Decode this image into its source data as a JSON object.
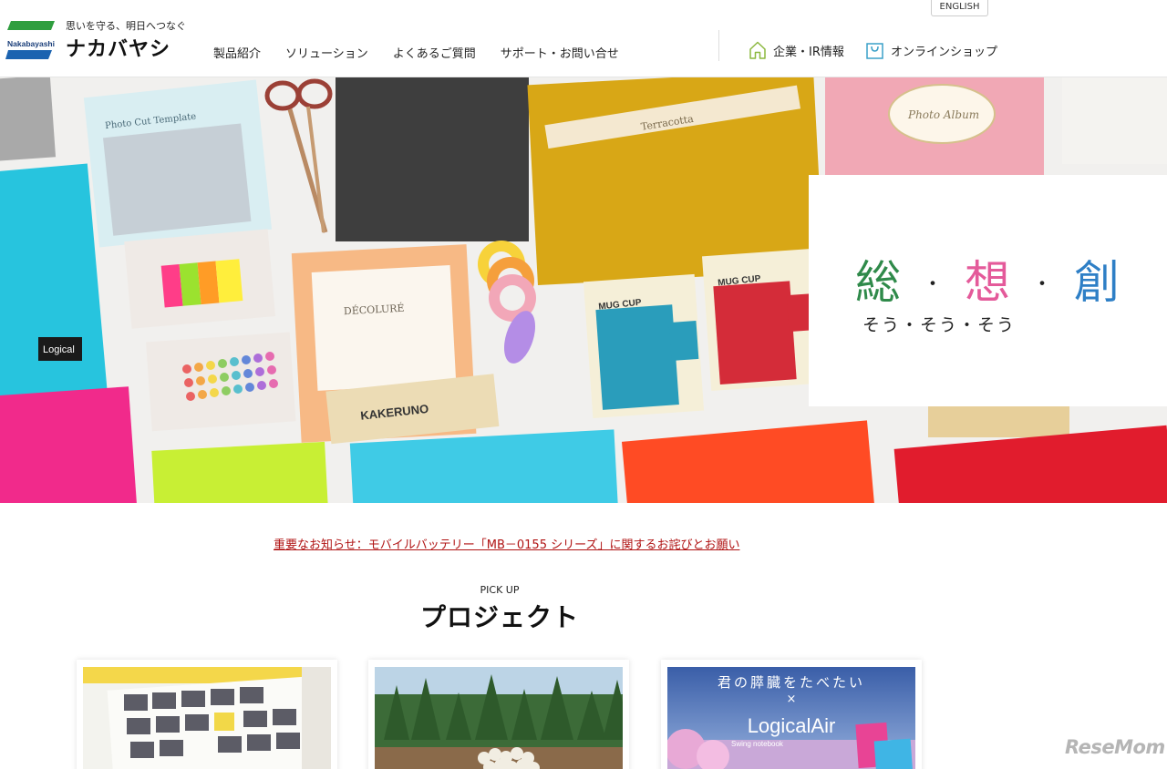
{
  "header": {
    "tagline": "思いを守る、明日へつなぐ",
    "logo_mark_text": "Nakabayashi",
    "logo_name": "ナカバヤシ",
    "english_label": "ENGLISH",
    "nav": [
      {
        "label": "製品紹介"
      },
      {
        "label": "ソリューション"
      },
      {
        "label": "よくあるご質問"
      },
      {
        "label": "サポート・お問い合せ"
      }
    ],
    "util": {
      "corporate_label": "企業・IR情報",
      "shop_label": "オンラインショップ"
    },
    "colors": {
      "brand_green": "#2f9e3f",
      "brand_blue": "#1b63b0"
    }
  },
  "hero": {
    "kanji": [
      "総",
      "想",
      "創"
    ],
    "kanji_colors": [
      "#2f8a4a",
      "#e45a9a",
      "#2e7fc6"
    ],
    "kana": "そう・そう・そう",
    "product_labels": {
      "photo_cut": "Photo Cut Template",
      "terracotta": "Terracotta",
      "photo_album": "Photo Album",
      "decolure": "DÉCOLURÉ",
      "kakeruno": "KAKERUNO",
      "mug_cup_1": "MUG CUP",
      "mug_cup_2": "MUG CUP",
      "logical": "Logical"
    }
  },
  "notice": {
    "text": "重要なお知らせ：モバイルバッテリー「MB－0155 シリーズ」に関するお詫びとお願い"
  },
  "pickup": {
    "label": "PICK UP",
    "title": "プロジェクト",
    "cards": [
      {
        "overlay": ""
      },
      {
        "overlay": ""
      },
      {
        "overlay_title": "君の膵臓をたべたい",
        "overlay_x": "×",
        "overlay_brand": "LogicalAir",
        "overlay_sub": "Swing notebook"
      }
    ]
  },
  "watermark": "ReseMom"
}
